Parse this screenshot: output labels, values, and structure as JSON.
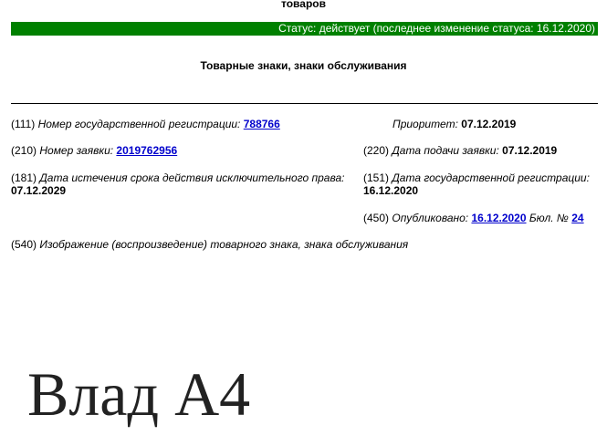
{
  "header": {
    "cut_text": "товаров"
  },
  "status": {
    "text": "Статус: действует (последнее изменение статуса: 16.12.2020)",
    "color": "#008000"
  },
  "document": {
    "title": "Товарные знаки, знаки обслуживания"
  },
  "fields": {
    "reg_number": {
      "code": "(111)",
      "label": "Номер государственной регистрации:",
      "value": "788766"
    },
    "priority": {
      "label": "Приоритет:",
      "value": "07.12.2019"
    },
    "application_number": {
      "code": "(210)",
      "label": "Номер заявки:",
      "value": "2019762956"
    },
    "filing_date": {
      "code": "(220)",
      "label": "Дата подачи заявки:",
      "value": "07.12.2019"
    },
    "expiry_date": {
      "code": "(181)",
      "label": "Дата истечения срока действия исключительного права:",
      "value": "07.12.2029"
    },
    "registration_date": {
      "code": "(151)",
      "label": "Дата государственной регистрации:",
      "value": "16.12.2020"
    },
    "published": {
      "code": "(450)",
      "label": "Опубликовано:",
      "value": "16.12.2020",
      "bulletin_label": "Бюл. №",
      "bulletin_number": "24"
    },
    "image": {
      "code": "(540)",
      "label": "Изображение (воспроизведение) товарного знака, знака обслуживания"
    }
  },
  "trademark": {
    "text": "Влад А4"
  }
}
